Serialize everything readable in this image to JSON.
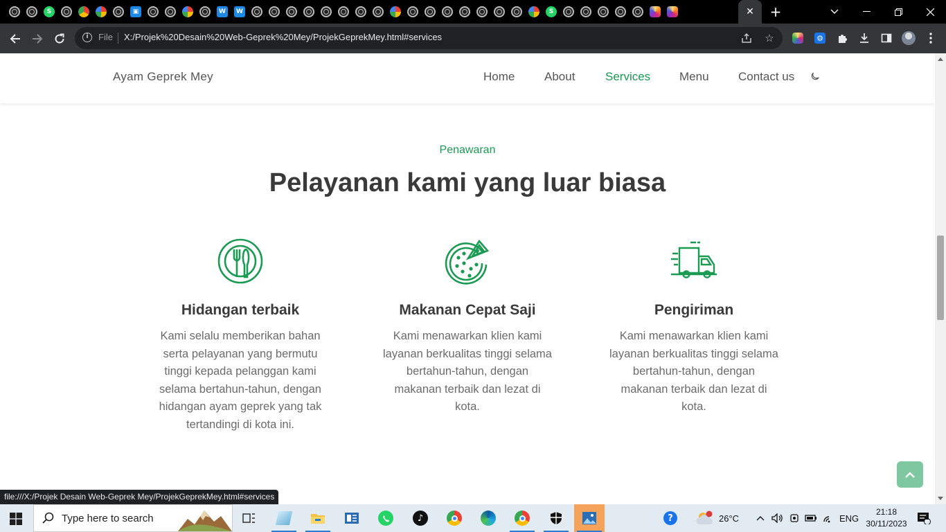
{
  "browser": {
    "active_tab_close": "✕",
    "new_tab": "+",
    "address": {
      "scheme_label": "File",
      "url": "X:/Projek%20Desain%20Web-Geprek%20Mey/ProjekGeprekMey.html#services"
    },
    "status_bar_url": "file:///X:/Projek Desain Web-Geprek Mey/ProjekGeprekMey.html#services",
    "favicons": [
      "globe",
      "globe",
      "whatsapp",
      "globe",
      "chrome",
      "google",
      "globe",
      "photos",
      "globe",
      "globe",
      "google",
      "globe",
      "w",
      "w",
      "globe",
      "globe",
      "globe",
      "globe",
      "globe",
      "globe",
      "globe",
      "globe",
      "google",
      "globe",
      "globe",
      "globe",
      "globe",
      "globe",
      "globe",
      "globe",
      "google",
      "whatsapp",
      "globe",
      "globe",
      "globe",
      "globe",
      "globe",
      "instagram",
      "instagram"
    ]
  },
  "site": {
    "logo": "Ayam Geprek Mey",
    "nav": [
      "Home",
      "About",
      "Services",
      "Menu",
      "Contact us"
    ],
    "active_nav": "Services",
    "theme_toggle_icon": "moon-icon",
    "accent_color": "#1a9a52"
  },
  "services": {
    "subtitle": "Penawaran",
    "title": "Pelayanan kami yang luar biasa",
    "cards": [
      {
        "icon": "dining-icon",
        "title": "Hidangan terbaik",
        "description": "Kami selalu memberikan bahan serta pelayanan yang bermutu tinggi kepada pelanggan kami selama bertahun-tahun, dengan hidangan ayam geprek yang tak tertandingi di kota ini."
      },
      {
        "icon": "pizza-icon",
        "title": "Makanan Cepat Saji",
        "description": "Kami menawarkan klien kami layanan berkualitas tinggi selama bertahun-tahun, dengan makanan terbaik dan lezat di kota."
      },
      {
        "icon": "delivery-truck-icon",
        "title": "Pengiriman",
        "description": "Kami menawarkan klien kami layanan berkualitas tinggi selama bertahun-tahun, dengan makanan terbaik dan lezat di kota."
      }
    ],
    "scroll_top_icon": "chevron-up-icon"
  },
  "taskbar": {
    "search_placeholder": "Type here to search",
    "weather_temp": "26°C",
    "language": "ENG",
    "time": "21:18",
    "date": "30/11/2023",
    "notification_count": "1"
  }
}
